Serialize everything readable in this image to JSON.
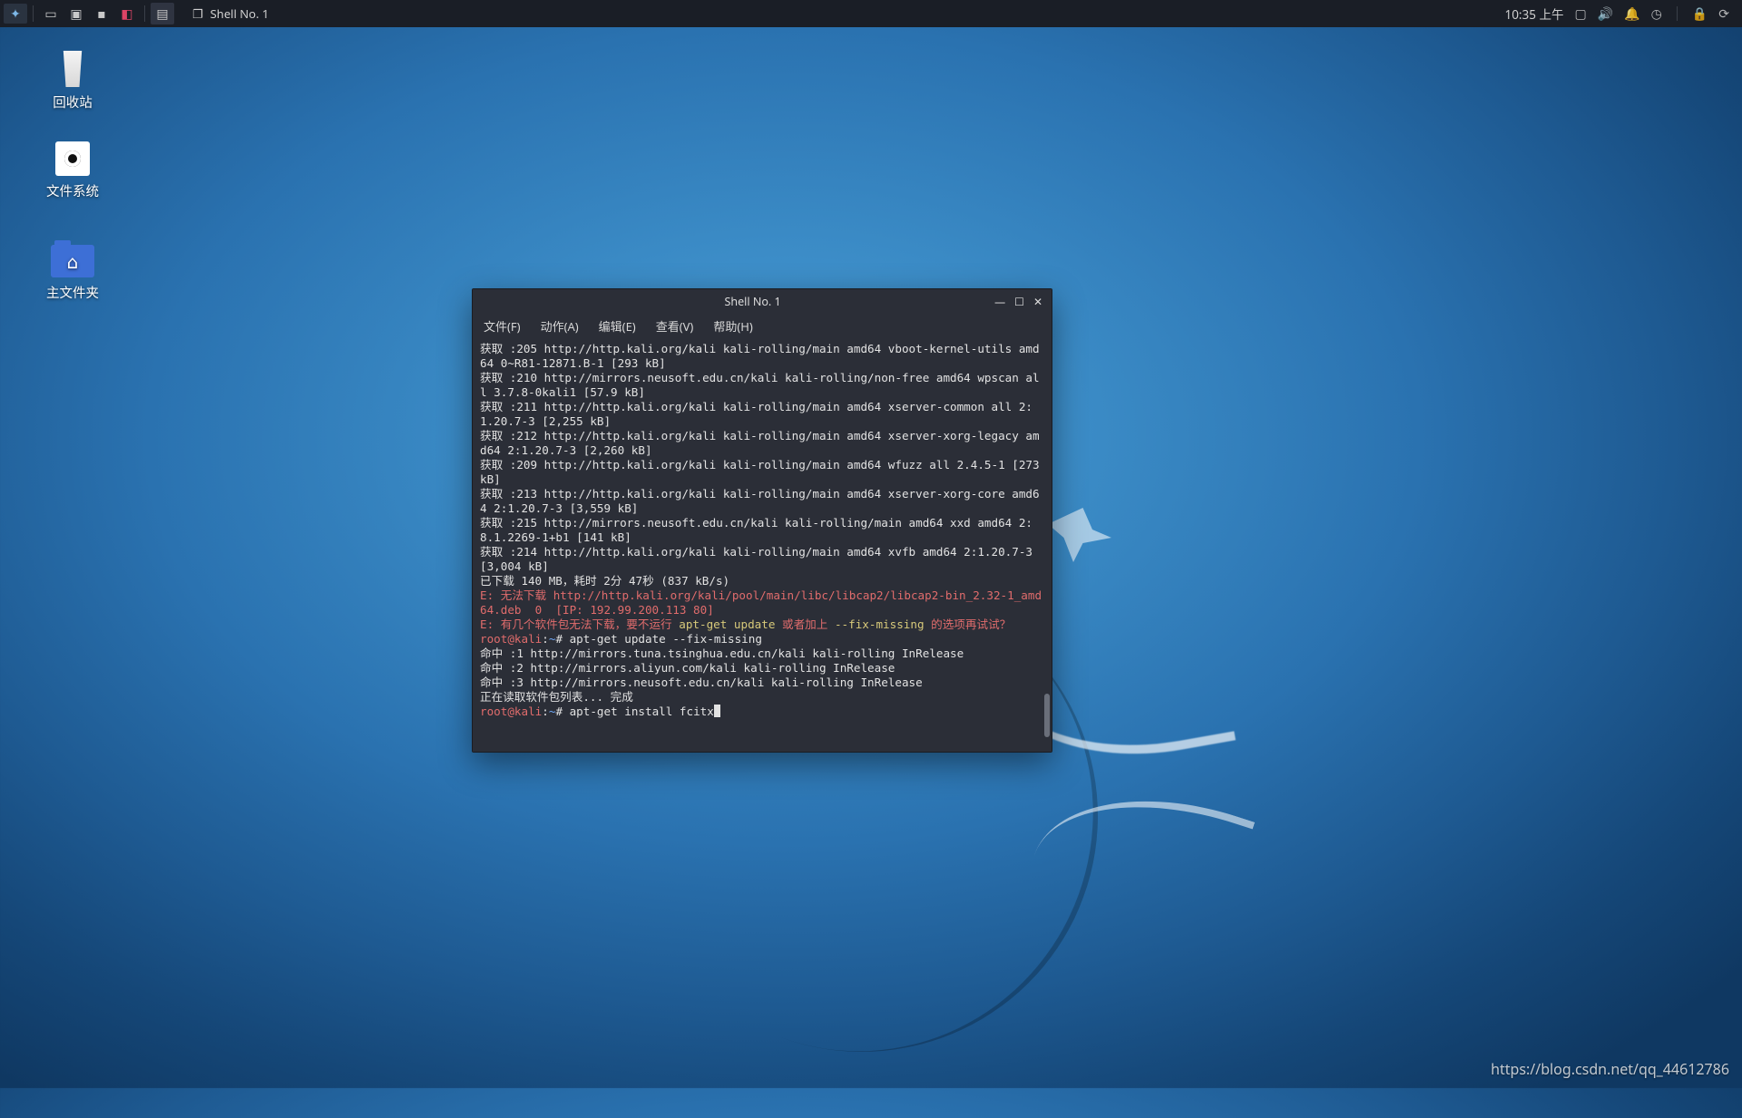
{
  "panel": {
    "taskbar_title": "Shell No. 1",
    "clock": "10:35 上午"
  },
  "desktop": {
    "trash": "回收站",
    "filesystem": "文件系统",
    "home": "主文件夹"
  },
  "terminal": {
    "title": "Shell No. 1",
    "menu": {
      "file": "文件(F)",
      "actions": "动作(A)",
      "edit": "编辑(E)",
      "view": "查看(V)",
      "help": "帮助(H)"
    },
    "lines": {
      "l01": "获取 :205 http://http.kali.org/kali kali-rolling/main amd64 vboot-kernel-utils amd64 0~R81-12871.B-1 [293 kB]",
      "l02": "获取 :210 http://mirrors.neusoft.edu.cn/kali kali-rolling/non-free amd64 wpscan all 3.7.8-0kali1 [57.9 kB]",
      "l03": "获取 :211 http://http.kali.org/kali kali-rolling/main amd64 xserver-common all 2:1.20.7-3 [2,255 kB]",
      "l04": "获取 :212 http://http.kali.org/kali kali-rolling/main amd64 xserver-xorg-legacy amd64 2:1.20.7-3 [2,260 kB]",
      "l05": "获取 :209 http://http.kali.org/kali kali-rolling/main amd64 wfuzz all 2.4.5-1 [273 kB]",
      "l06": "获取 :213 http://http.kali.org/kali kali-rolling/main amd64 xserver-xorg-core amd64 2:1.20.7-3 [3,559 kB]",
      "l07": "获取 :215 http://mirrors.neusoft.edu.cn/kali kali-rolling/main amd64 xxd amd64 2:8.1.2269-1+b1 [141 kB]",
      "l08": "获取 :214 http://http.kali.org/kali kali-rolling/main amd64 xvfb amd64 2:1.20.7-3 [3,004 kB]",
      "l09": "已下载 140 MB，耗时 2分 47秒 (837 kB/s)",
      "l10a": "E: 无法下载 http://http.kali.org/kali/pool/main/libc/libcap2/libcap2-bin_2.32-1_amd64.deb  0  [IP: 192.99.200.113 80]",
      "l11a": "E: 有几个软件包无法下载，要不运行 ",
      "l11b": "apt-get update",
      "l11c": " 或者加上 ",
      "l11d": "--fix-missing",
      "l11e": " 的选项再试试？",
      "l12p": "root@kali",
      "l12q": ":",
      "l12r": "~",
      "l12s": "# apt-get update --fix-missing",
      "l13": "命中 :1 http://mirrors.tuna.tsinghua.edu.cn/kali kali-rolling InRelease",
      "l14": "命中 :2 http://mirrors.aliyun.com/kali kali-rolling InRelease",
      "l15": "命中 :3 http://mirrors.neusoft.edu.cn/kali kali-rolling InRelease",
      "l16": "正在读取软件包列表... 完成",
      "l17p": "root@kali",
      "l17q": ":",
      "l17r": "~",
      "l17s": "# apt-get install fcitx"
    }
  },
  "watermark": "https://blog.csdn.net/qq_44612786"
}
